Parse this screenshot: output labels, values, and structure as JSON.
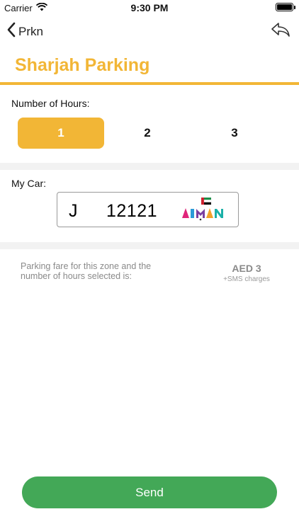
{
  "status_bar": {
    "carrier": "Carrier",
    "time": "9:30 PM"
  },
  "nav": {
    "back_label": "Prkn"
  },
  "zone": {
    "title": "Sharjah Parking"
  },
  "hours": {
    "label": "Number of Hours:",
    "options": [
      "1",
      "2",
      "3"
    ],
    "selected": "1"
  },
  "car": {
    "label": "My Car:",
    "plate_letter": "J",
    "plate_number": "12121"
  },
  "fare": {
    "text": "Parking fare for this zone and the number of hours selected is:",
    "amount": "AED 3",
    "note": "+SMS charges"
  },
  "actions": {
    "send_label": "Send"
  },
  "colors": {
    "accent": "#f2b636",
    "send": "#43a857",
    "muted_text": "#8a8a8a"
  }
}
